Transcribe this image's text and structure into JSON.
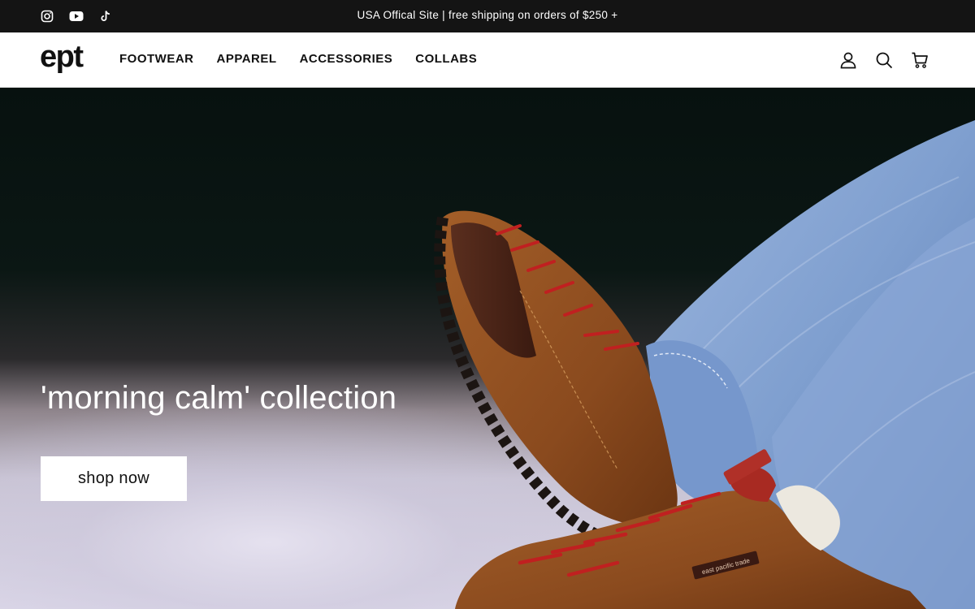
{
  "announcement": {
    "text": "USA Offical Site | free shipping on orders of $250 +",
    "social_icons": [
      "instagram-icon",
      "youtube-icon",
      "tiktok-icon"
    ]
  },
  "header": {
    "logo": "ept",
    "nav": [
      "FOOTWEAR",
      "APPAREL",
      "ACCESSORIES",
      "COLLABS"
    ],
    "tool_icons": [
      "account-icon",
      "search-icon",
      "cart-icon"
    ]
  },
  "hero": {
    "headline": "'morning calm' collection",
    "cta_label": "shop now",
    "shoe_tag_text": "east pacific trade"
  },
  "colors": {
    "announcement_bg": "#141414",
    "header_bg": "#ffffff",
    "text": "#111111",
    "suede": "#8a4a1e",
    "laces": "#c02020",
    "denim": "#7f9fcf"
  }
}
